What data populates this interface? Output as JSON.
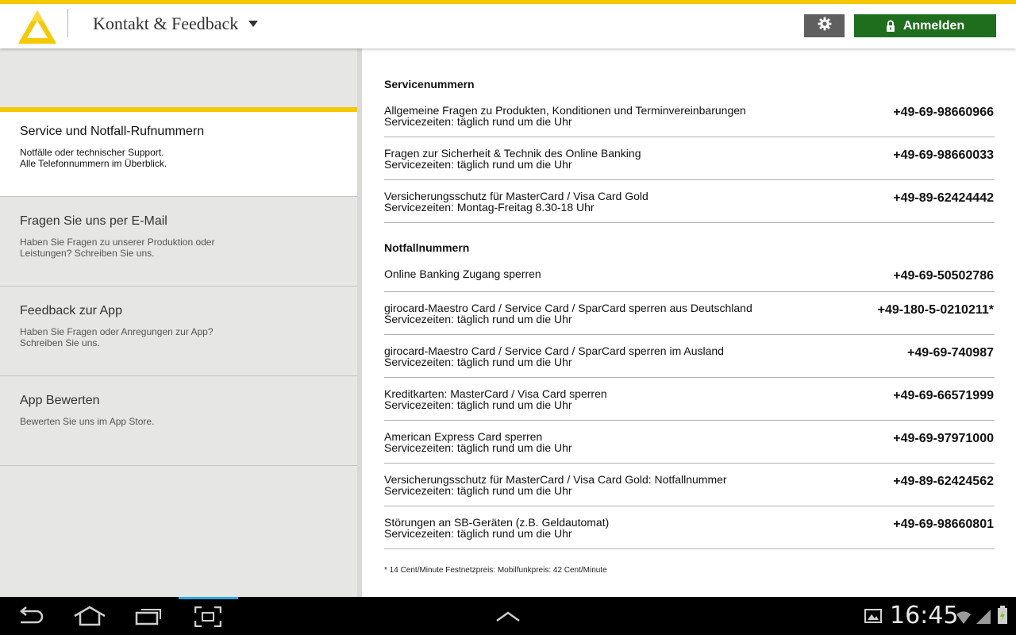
{
  "colors": {
    "accent_yellow": "#f6c800",
    "login_green": "#1f6e1d",
    "settings_gray": "#5f5f5f",
    "sidebar_bg": "#e6e6e4"
  },
  "header": {
    "title": "Kontakt & Feedback",
    "settings_icon": "gear-icon",
    "login_label": "Anmelden",
    "login_icon": "lock-icon"
  },
  "sidebar": {
    "items": [
      {
        "title": "Service und Notfall-Rufnummern",
        "desc": "Notfälle oder technischer Support.\nAlle Telefonnummern im Überblick.",
        "active": true
      },
      {
        "title": "Fragen Sie uns per E-Mail",
        "desc": "Haben Sie Fragen zu unserer Produktion oder\nLeistungen? Schreiben Sie uns.",
        "active": false
      },
      {
        "title": "Feedback zur App",
        "desc": "Haben Sie Fragen oder Anregungen zur App?\nSchreiben Sie uns.",
        "active": false
      },
      {
        "title": "App Bewerten",
        "desc": "Bewerten Sie uns im App Store.",
        "active": false
      }
    ]
  },
  "main": {
    "service": {
      "heading": "Servicenummern",
      "rows": [
        {
          "label": "Allgemeine Fragen zu Produkten, Konditionen und Terminvereinbarungen",
          "sub": "Servicezeiten: täglich rund um die Uhr",
          "phone": "+49-69-98660966"
        },
        {
          "label": "Fragen zur Sicherheit & Technik des Online Banking",
          "sub": "Servicezeiten: täglich rund um die Uhr",
          "phone": "+49-69-98660033"
        },
        {
          "label": "Versicherungsschutz für MasterCard / Visa Card Gold",
          "sub": "Servicezeiten: Montag-Freitag 8.30-18 Uhr",
          "phone": "+49-89-62424442"
        }
      ]
    },
    "emergency": {
      "heading": "Notfallnummern",
      "rows": [
        {
          "label": "Online Banking Zugang sperren",
          "sub": "",
          "phone": "+49-69-50502786"
        },
        {
          "label": "girocard-Maestro Card / Service Card / SparCard sperren aus Deutschland",
          "sub": "Servicezeiten: täglich rund um die Uhr",
          "phone": "+49-180-5-0210211*"
        },
        {
          "label": "girocard-Maestro Card / Service Card / SparCard sperren im Ausland",
          "sub": "Servicezeiten: täglich rund um die Uhr",
          "phone": "+49-69-740987"
        },
        {
          "label": "Kreditkarten: MasterCard / Visa Card sperren",
          "sub": "Servicezeiten: täglich rund um die Uhr",
          "phone": "+49-69-66571999"
        },
        {
          "label": "American Express Card sperren",
          "sub": "Servicezeiten: täglich rund um die Uhr",
          "phone": "+49-69-97971000"
        },
        {
          "label": "Versicherungsschutz für MasterCard / Visa Card Gold: Notfallnummer",
          "sub": "Servicezeiten: täglich rund um die Uhr",
          "phone": "+49-89-62424562"
        },
        {
          "label": "Störungen an SB-Geräten (z.B. Geldautomat)",
          "sub": "Servicezeiten: täglich rund um die Uhr",
          "phone": "+49-69-98660801"
        }
      ]
    },
    "footnote": "* 14 Cent/Minute Festnetzpreis: Mobilfunkpreis: 42 Cent/Minute"
  },
  "system_bar": {
    "time": "16:45",
    "icons": [
      "back-icon",
      "home-icon",
      "recent-apps-icon",
      "screenshot-icon",
      "up-chevron-icon",
      "gallery-icon",
      "wifi-icon",
      "signal-icon",
      "battery-icon"
    ]
  }
}
